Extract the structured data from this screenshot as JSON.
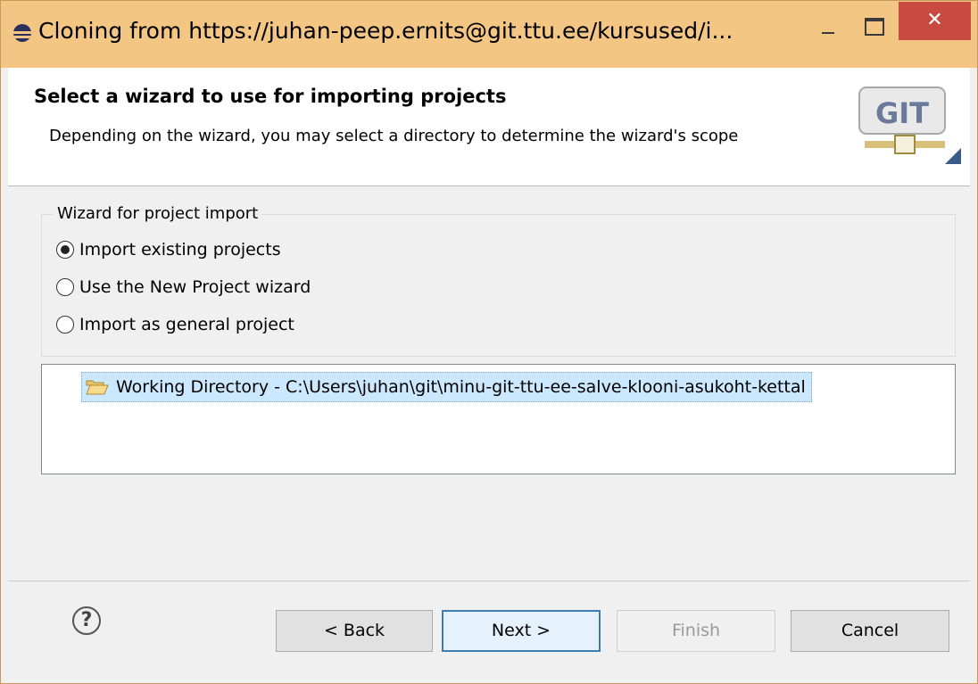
{
  "window": {
    "title": "Cloning from https://juhan-peep.ernits@git.ttu.ee/kursused/i...",
    "controls": {
      "minimize_label": "–",
      "close_label": "✕"
    }
  },
  "header": {
    "title": "Select a wizard to use for importing projects",
    "description": "Depending on the wizard, you may select a directory to determine the wizard's scope",
    "logo_text": "GIT"
  },
  "wizard_group": {
    "label": "Wizard for project import",
    "options": [
      {
        "label": "Import existing projects",
        "selected": true
      },
      {
        "label": "Use the New Project wizard",
        "selected": false
      },
      {
        "label": "Import as general project",
        "selected": false
      }
    ]
  },
  "tree": {
    "items": [
      {
        "label": "Working Directory - C:\\Users\\juhan\\git\\minu-git-ttu-ee-salve-klooni-asukoht-kettal",
        "icon": "folder-open-icon"
      }
    ]
  },
  "footer": {
    "help_label": "?",
    "back_label": "< Back",
    "next_label": "Next >",
    "finish_label": "Finish",
    "cancel_label": "Cancel"
  },
  "colors": {
    "titlebar": "#f4c683",
    "close": "#c94a40",
    "selection": "#cce8ff",
    "default_button_border": "#3c7fb1"
  }
}
